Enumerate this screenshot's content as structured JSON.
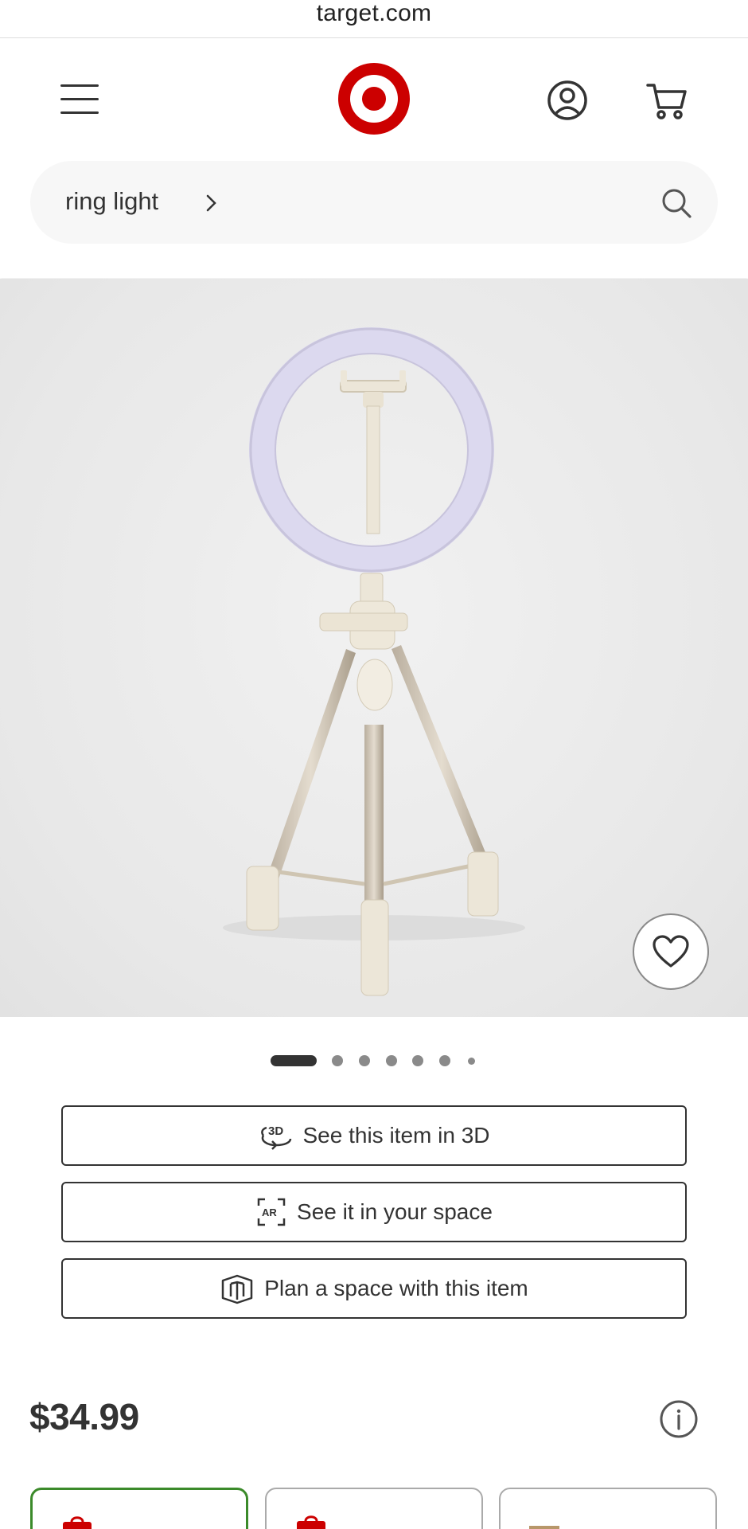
{
  "browser": {
    "url": "target.com"
  },
  "header": {
    "menu_icon": "hamburger-menu-icon",
    "logo": "target-bullseye-logo",
    "account_icon": "account-icon",
    "cart_icon": "cart-icon"
  },
  "search": {
    "query": "ring light",
    "icon": "search-icon"
  },
  "product": {
    "image_alt": "ring light on tripod stand",
    "favorite_icon": "heart-icon",
    "carousel": {
      "total": 7,
      "active": 1
    },
    "actions": [
      {
        "label": "See this item in 3D",
        "icon": "3d-rotate-icon"
      },
      {
        "label": "See it in your space",
        "icon": "ar-icon"
      },
      {
        "label": "Plan a space with this item",
        "icon": "room-plan-icon"
      }
    ],
    "price": "$34.99",
    "info_icon": "info-icon"
  },
  "fulfillment": {
    "options": [
      {
        "icon": "store-bag-icon",
        "selected": true
      },
      {
        "icon": "store-bag-icon",
        "selected": false
      },
      {
        "icon": "shipping-box-icon",
        "selected": false
      }
    ]
  },
  "colors": {
    "brand_red": "#cc0000",
    "text": "#333333",
    "selected_green": "#3b8a2a",
    "search_bg": "#f7f7f7"
  }
}
